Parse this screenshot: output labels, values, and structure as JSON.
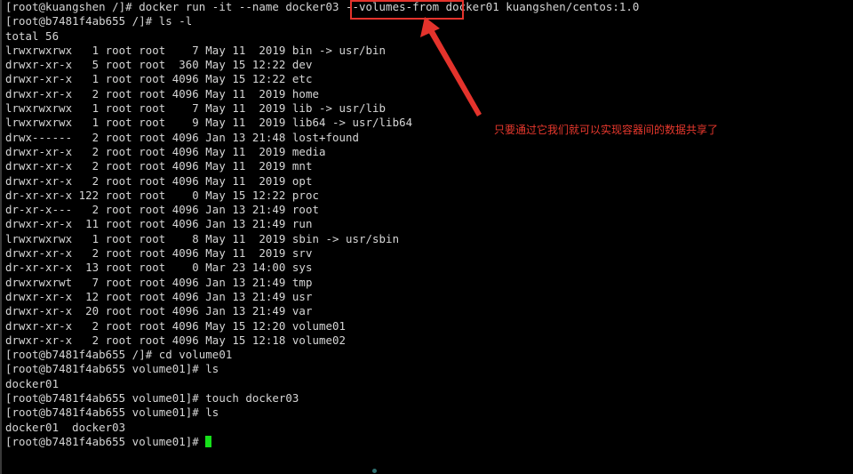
{
  "terminal": {
    "lines": [
      "[root@kuangshen /]# docker run -it --name docker03 --volumes-from docker01 kuangshen/centos:1.0",
      "[root@b7481f4ab655 /]# ls -l",
      "total 56",
      "lrwxrwxrwx   1 root root    7 May 11  2019 bin -> usr/bin",
      "drwxr-xr-x   5 root root  360 May 15 12:22 dev",
      "drwxr-xr-x   1 root root 4096 May 15 12:22 etc",
      "drwxr-xr-x   2 root root 4096 May 11  2019 home",
      "lrwxrwxrwx   1 root root    7 May 11  2019 lib -> usr/lib",
      "lrwxrwxrwx   1 root root    9 May 11  2019 lib64 -> usr/lib64",
      "drwx------   2 root root 4096 Jan 13 21:48 lost+found",
      "drwxr-xr-x   2 root root 4096 May 11  2019 media",
      "drwxr-xr-x   2 root root 4096 May 11  2019 mnt",
      "drwxr-xr-x   2 root root 4096 May 11  2019 opt",
      "dr-xr-xr-x 122 root root    0 May 15 12:22 proc",
      "dr-xr-x---   2 root root 4096 Jan 13 21:49 root",
      "drwxr-xr-x  11 root root 4096 Jan 13 21:49 run",
      "lrwxrwxrwx   1 root root    8 May 11  2019 sbin -> usr/sbin",
      "drwxr-xr-x   2 root root 4096 May 11  2019 srv",
      "dr-xr-xr-x  13 root root    0 Mar 23 14:00 sys",
      "drwxrwxrwt   7 root root 4096 Jan 13 21:49 tmp",
      "drwxr-xr-x  12 root root 4096 Jan 13 21:49 usr",
      "drwxr-xr-x  20 root root 4096 Jan 13 21:49 var",
      "drwxr-xr-x   2 root root 4096 May 15 12:20 volume01",
      "drwxr-xr-x   2 root root 4096 May 15 12:18 volume02",
      "[root@b7481f4ab655 /]# cd volume01",
      "[root@b7481f4ab655 volume01]# ls",
      "docker01",
      "[root@b7481f4ab655 volume01]# touch docker03",
      "[root@b7481f4ab655 volume01]# ls",
      "docker01  docker03"
    ],
    "prompt": "[root@b7481f4ab655 volume01]# "
  },
  "annotation": {
    "text": "只要通过它我们就可以实现容器间的数据共享了",
    "color": "#e8382d",
    "highlighted_option": "--volumes-from"
  },
  "colors": {
    "background": "#000000",
    "text": "#d6d6d6",
    "cursor": "#16e01a",
    "annotation": "#e4332c"
  }
}
